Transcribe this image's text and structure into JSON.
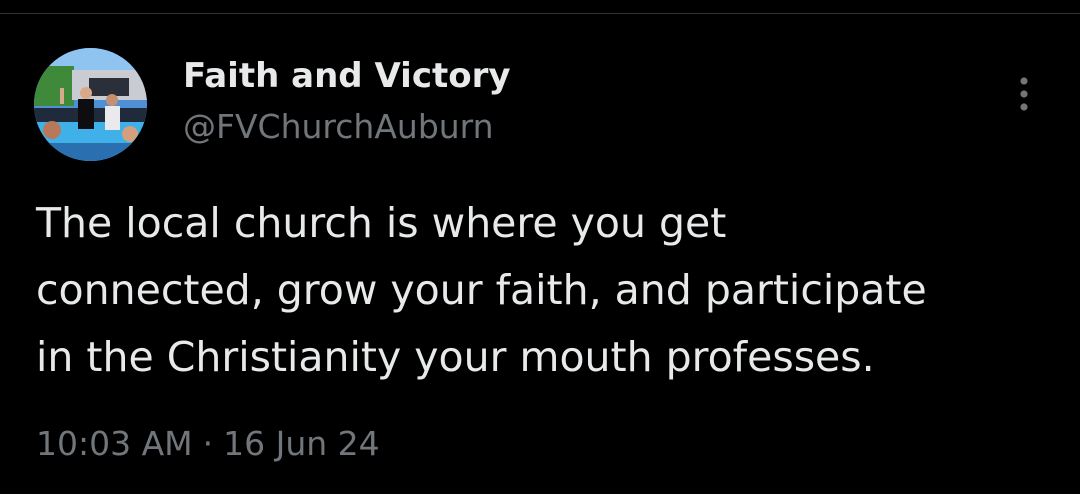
{
  "theme": {
    "background": "#000000",
    "text_primary": "#e7e9ea",
    "text_secondary": "#71767b",
    "divider": "#2f3336"
  },
  "author": {
    "display_name": "Faith and Victory",
    "handle": "@FVChurchAuburn",
    "avatar_icon": "profile-photo-baptism"
  },
  "menu": {
    "icon": "more-vertical-icon"
  },
  "tweet": {
    "text": "The local church is where you get\nconnected, grow your faith, and participate\nin the Christianity your mouth professes.",
    "time": "10:03 AM",
    "separator": "·",
    "date": "16 Jun 24"
  }
}
